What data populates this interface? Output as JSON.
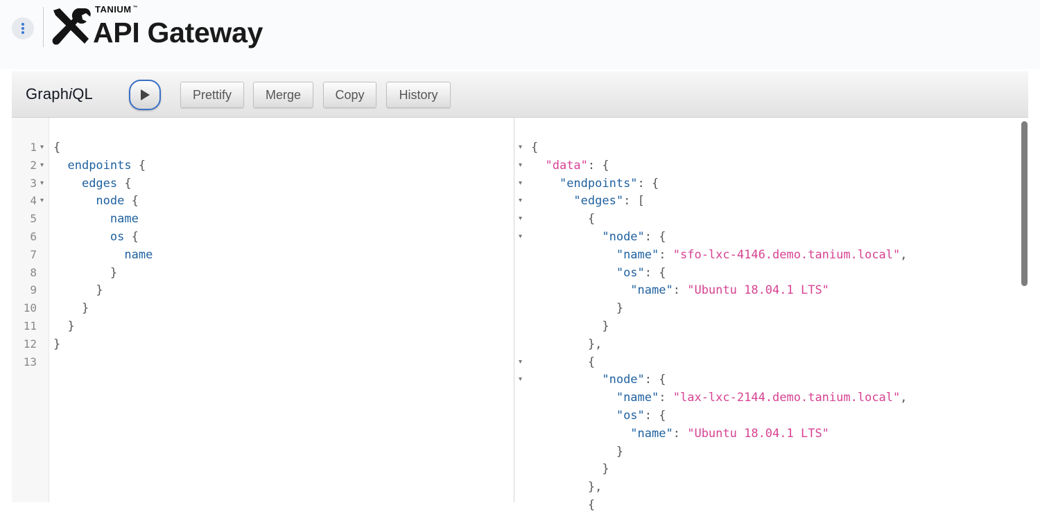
{
  "header": {
    "brand_small": "TANIUM",
    "brand_trademark": "™",
    "title": "API Gateway",
    "menu_icon": "kebab-menu-icon",
    "logo_icon": "tools-logo-icon",
    "background_color": "#fafbfc"
  },
  "toolbar": {
    "title_prefix": "Graph",
    "title_italic": "i",
    "title_suffix": "QL",
    "execute_icon": "play-icon",
    "buttons": [
      "Prettify",
      "Merge",
      "Copy",
      "History"
    ]
  },
  "query_editor": {
    "line_numbers": [
      "1",
      "2",
      "3",
      "4",
      "5",
      "6",
      "7",
      "8",
      "9",
      "10",
      "11",
      "12",
      "13"
    ],
    "folded_lines": [
      "1",
      "2",
      "3",
      "4"
    ],
    "fold_icon": "fold-arrow-icon",
    "lines": [
      "{",
      "  endpoints {",
      "    edges {",
      "      node {",
      "        name",
      "        os {",
      "          name",
      "        }",
      "      }",
      "    }",
      "  }",
      "}",
      ""
    ]
  },
  "result_viewer": {
    "fold_icon": "fold-arrow-icon",
    "lines": [
      "{",
      "  \"data\": {",
      "    \"endpoints\": {",
      "      \"edges\": [",
      "        {",
      "          \"node\": {",
      "            \"name\": \"sfo-lxc-4146.demo.tanium.local\",",
      "            \"os\": {",
      "              \"name\": \"Ubuntu 18.04.1 LTS\"",
      "            }",
      "          }",
      "        },",
      "        {",
      "          \"node\": {",
      "            \"name\": \"lax-lxc-2144.demo.tanium.local\",",
      "            \"os\": {",
      "              \"name\": \"Ubuntu 18.04.1 LTS\"",
      "            }",
      "          }",
      "        },",
      "        {"
    ],
    "folded_lines": [
      "1",
      "2",
      "3",
      "4",
      "5",
      "6",
      "13",
      "14"
    ]
  },
  "colors": {
    "field": "#1f61a0",
    "string": "#d64292",
    "punctuation": "#555555",
    "execute_border": "#3a6fc6"
  }
}
